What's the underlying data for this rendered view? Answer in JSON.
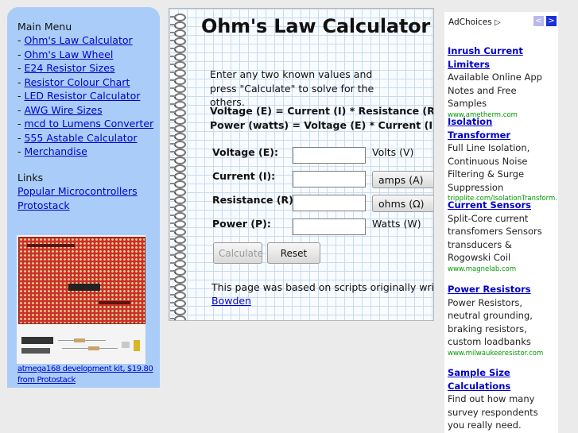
{
  "sidebar": {
    "menu_title": "Main Menu",
    "menu_items": [
      {
        "prefix": "- ",
        "label": "Ohm's Law Calculator"
      },
      {
        "prefix": "- ",
        "label": "Ohm's Law Wheel"
      },
      {
        "prefix": "- ",
        "label": "E24 Resistor Sizes"
      },
      {
        "prefix": "- ",
        "label": "Resistor Colour Chart"
      },
      {
        "prefix": "- ",
        "label": "LED Resistor Calculator"
      },
      {
        "prefix": "- ",
        "label": "AWG Wire Sizes"
      },
      {
        "prefix": "- ",
        "label": "mcd to Lumens Converter"
      },
      {
        "prefix": "- ",
        "label": "555 Astable Calculator"
      },
      {
        "prefix": "- ",
        "label": "Merchandise"
      }
    ],
    "links_title": "Links",
    "links": [
      "Popular Microcontrollers",
      "Protostack"
    ],
    "product_caption": "atmega168 development kit, $19.80 from Protostack"
  },
  "calculator": {
    "title": "Ohm's Law Calculator",
    "intro": "Enter any two known values and press \"Calculate\" to solve for the others.",
    "formula_voltage": "Voltage (E) = Current (I) * Resistance (R)",
    "formula_power": "Power (watts) = Voltage (E) * Current (I)",
    "rows": [
      {
        "label": "Voltage (E):",
        "value": "",
        "unit": "Volts (V)"
      },
      {
        "label": "Current (I):",
        "value": "",
        "unit": "amps (A)"
      },
      {
        "label": "Resistance (R):",
        "value": "",
        "unit": "ohms (Ω)"
      },
      {
        "label": "Power (P):",
        "value": "",
        "unit": "Watts (W)"
      }
    ],
    "calculate_label": "Calculate",
    "reset_label": "Reset",
    "footer_text": "This page was based on scripts originally writt",
    "footer_link": "Bowden"
  },
  "ads": {
    "adchoices_label": "AdChoices",
    "adchoices_icon": "▷",
    "prev_icon": "<",
    "next_icon": ">",
    "items": [
      {
        "title": "Inrush Current Limiters",
        "body": "Available Online App Notes and Free Samples",
        "url": "www.ametherm.com"
      },
      {
        "title": "Isolation Transformer",
        "body": "Full Line Isolation, Continuous Noise Filtering & Surge Suppression",
        "url": "tripplite.com/IsolationTransform..."
      },
      {
        "title": "Current Sensors",
        "body": "Split-Core current transfomers Sensors transducers & Rogowski Coil",
        "url": "www.magnelab.com"
      },
      {
        "title": "Power Resistors",
        "body": "Power Resistors, neutral grounding, braking resistors, custom loadbanks",
        "url": "www.milwaukeeresistor.com"
      },
      {
        "title": "Sample Size Calculations",
        "body": "Find out how many survey respondents you really need.",
        "url": ""
      }
    ]
  }
}
